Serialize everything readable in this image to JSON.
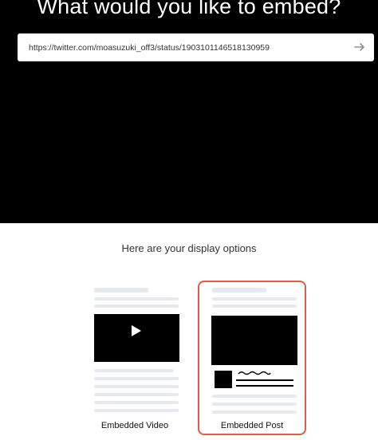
{
  "hero": {
    "title": "What would you like to embed?"
  },
  "url_bar": {
    "value": "https://twitter.com/moasuzuki_off3/status/1903101146518130959",
    "submit_icon": "arrow-right-icon"
  },
  "options": {
    "title": "Here are your display options",
    "items": [
      {
        "label": "Embedded Video",
        "selected": false,
        "icon": "play-icon"
      },
      {
        "label": "Embedded Post",
        "selected": true
      }
    ]
  },
  "colors": {
    "hero_bg": "#000000",
    "selected_border": "#e05a47",
    "placeholder_line": "#e6e9ee"
  }
}
